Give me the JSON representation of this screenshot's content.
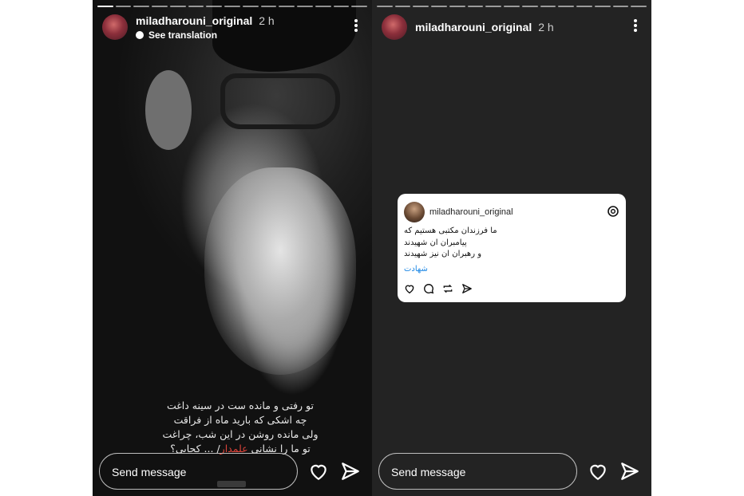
{
  "left_story": {
    "username": "miladharouni_original",
    "time": "2 h",
    "translation_label": "See translation",
    "progress_segments": 15,
    "progress_current_index": 0,
    "poem_lines": [
      "تو رفتی و مانده ست در سینه داغت",
      "چه اشکی که بارید ماه از فراقت",
      "ولی مانده روشن در این شب، چراغت",
      "تو ما را نشانی علمدار/ ... کجایی؟"
    ],
    "poem_highlight_word": "علمدار",
    "send_placeholder": "Send message"
  },
  "right_story": {
    "username": "miladharouni_original",
    "time": "2 h",
    "progress_segments": 15,
    "card": {
      "username": "miladharouni_original",
      "lines": [
        "ما فرزندان مکتبی هستیم که",
        "پیامبران ان شهیدند",
        "و رهبران ان نیز شهیدند"
      ],
      "tag": "شهادت",
      "icons": [
        "heart-icon",
        "comment-icon",
        "repost-icon",
        "share-icon"
      ]
    },
    "send_placeholder": "Send message"
  },
  "colors": {
    "outer_background": "#ffffff",
    "left_story_bg": "#1b1b1b",
    "right_story_bg": "#232323",
    "tag_blue": "#1e88e5",
    "highlight_red": "#e0443b"
  }
}
